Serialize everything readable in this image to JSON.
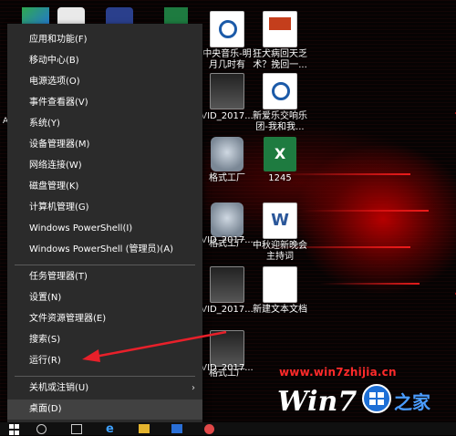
{
  "start_menu": {
    "groups": [
      [
        {
          "label": "应用和功能(F)"
        },
        {
          "label": "移动中心(B)"
        },
        {
          "label": "电源选项(O)"
        },
        {
          "label": "事件查看器(V)"
        },
        {
          "label": "系统(Y)"
        },
        {
          "label": "设备管理器(M)"
        },
        {
          "label": "网络连接(W)"
        },
        {
          "label": "磁盘管理(K)"
        },
        {
          "label": "计算机管理(G)"
        },
        {
          "label": "Windows PowerShell(I)"
        },
        {
          "label": "Windows PowerShell (管理员)(A)"
        }
      ],
      [
        {
          "label": "任务管理器(T)"
        },
        {
          "label": "设置(N)"
        },
        {
          "label": "文件资源管理器(E)"
        },
        {
          "label": "搜索(S)"
        },
        {
          "label": "运行(R)"
        }
      ],
      [
        {
          "label": "关机或注销(U)",
          "submenu_arrow": "›"
        },
        {
          "label": "桌面(D)"
        }
      ]
    ]
  },
  "desktop_icons": [
    {
      "label": "中央音乐-明月几时有",
      "icon": "audio-file-icon"
    },
    {
      "label": "狂犬病回天乏术？挽回一...",
      "icon": "powerpoint-file-icon"
    },
    {
      "label": "VID_2017...",
      "icon": "video-file-icon"
    },
    {
      "label": "新爱乐交响乐团-我和我...",
      "icon": "audio-file-icon"
    },
    {
      "label": "格式工厂",
      "icon": "format-factory-icon"
    },
    {
      "label": "1245",
      "icon": "excel-file-icon"
    },
    {
      "label": "格式工厂",
      "icon": "format-factory-icon"
    },
    {
      "label": "VID_2017...",
      "icon": "video-file-icon"
    },
    {
      "label": "中秋迎新晚会主持词",
      "icon": "word-file-icon"
    },
    {
      "label": "VID_2017...",
      "icon": "video-file-icon"
    },
    {
      "label": "新建文本文档",
      "icon": "text-file-icon"
    },
    {
      "label": "格式工厂",
      "icon": "format-factory-icon"
    },
    {
      "label": "VID_2017...",
      "icon": "video-file-icon"
    }
  ],
  "watermark": {
    "url": "www.win7zhijia.cn",
    "logo_text": "Win7",
    "logo_suffix": "之家"
  },
  "colors": {
    "menu_bg": "#2b2b2b",
    "menu_highlight": "#414141",
    "annotation_arrow": "#e8202a",
    "watermark_red": "#ff2a2a"
  },
  "edge_text": "A"
}
